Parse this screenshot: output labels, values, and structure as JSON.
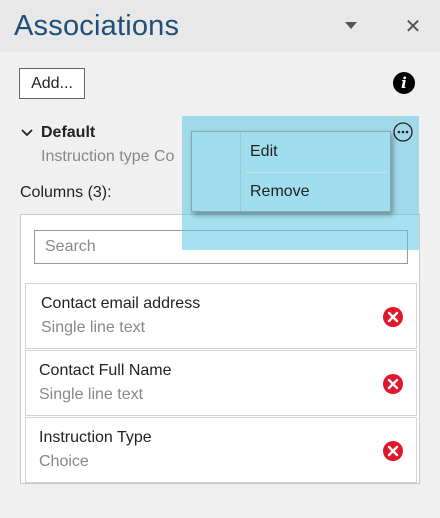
{
  "pane": {
    "title": "Associations",
    "add_label": "Add...",
    "info_label": "i",
    "close_glyph": "✕"
  },
  "association": {
    "name": "Default",
    "subtitle": "Instruction type Co",
    "columns_label": "Columns (3):"
  },
  "search": {
    "placeholder": "Search",
    "value": ""
  },
  "columns": [
    {
      "name": "Contact email address",
      "type": "Single line text"
    },
    {
      "name": "Contact Full Name",
      "type": "Single line text"
    },
    {
      "name": "Instruction Type",
      "type": "Choice"
    }
  ],
  "context_menu": {
    "items": [
      {
        "label": "Edit"
      },
      {
        "label": "Remove"
      }
    ]
  },
  "icons": {
    "dropdown": "chevron-down-icon",
    "close": "close-icon",
    "info": "info-icon",
    "collapse": "chevron-down-icon",
    "more": "more-options-icon",
    "remove": "remove-icon"
  },
  "colors": {
    "title": "#1f4e79",
    "highlight": "#5fc8e6",
    "remove": "#e0182d"
  }
}
